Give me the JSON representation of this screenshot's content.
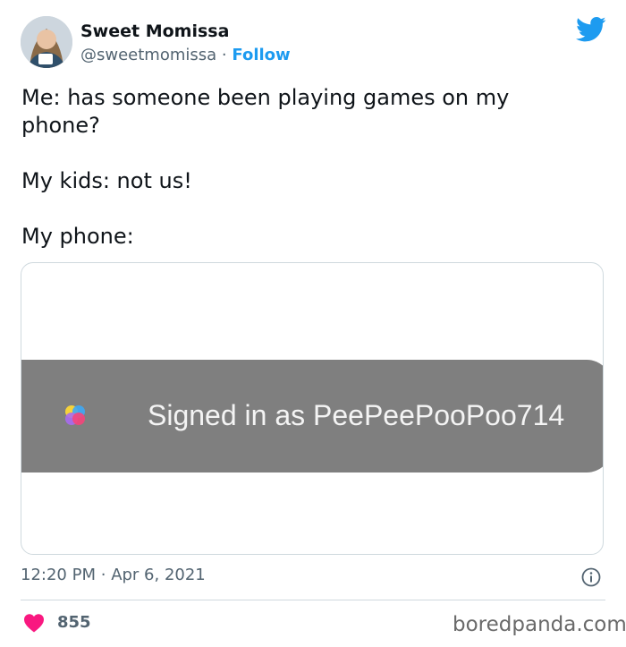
{
  "author": {
    "display_name": "Sweet Momissa",
    "handle": "@sweetmomissa",
    "separator": "·",
    "follow_label": "Follow"
  },
  "icons": {
    "avatar": "avatar-photo",
    "platform": "twitter-bird-icon",
    "info": "info-icon",
    "like": "heart-icon",
    "media_app": "game-center-icon"
  },
  "tweet": {
    "lines": [
      "Me: has someone been playing games on my phone?",
      "My kids: not us!",
      "My phone:"
    ]
  },
  "media": {
    "banner_text": "Signed in as PeePeePooPoo714"
  },
  "meta": {
    "time": "12:20 PM",
    "separator": "·",
    "date": "Apr 6, 2021"
  },
  "engagement": {
    "likes": "855"
  },
  "watermark": "boredpanda.com",
  "colors": {
    "accent": "#1d9bf0",
    "heart": "#f91880",
    "banner": "#7f7f7f",
    "muted_text": "#536471"
  }
}
